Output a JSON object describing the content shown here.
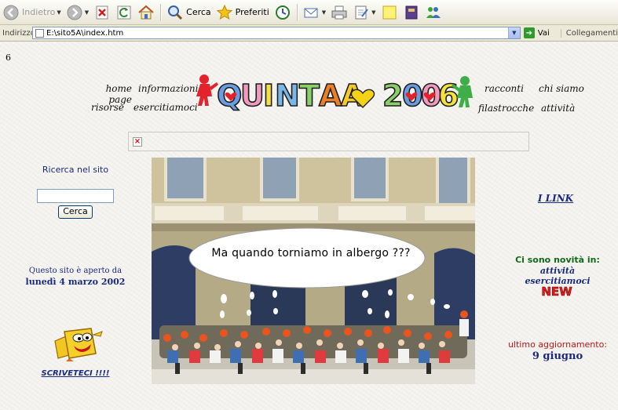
{
  "toolbar": {
    "back_label": "Indietro",
    "search_label": "Cerca",
    "favorites_label": "Preferiti"
  },
  "address": {
    "label": "Indirizzo",
    "url": "E:\\sito5A\\index.htm",
    "go_label": "Vai",
    "links_label": "Collegamenti"
  },
  "page": {
    "counter": "6",
    "nav": {
      "home": "home page",
      "informazioni": "informazioni",
      "risorse": "risorse",
      "esercitiamoci": "esercitiamoci",
      "racconti": "racconti",
      "chi_siamo": "chi siamo",
      "filastrocche": "filastrocche",
      "attivita": "attività"
    },
    "banner_text": "QUINTA A 2006",
    "search": {
      "title": "Ricerca nel sito",
      "button": "Cerca",
      "value": ""
    },
    "since_line1": "Questo sito è aperto da",
    "since_line2": "lunedì 4 marzo 2002",
    "write_link": "SCRIVETECI !!!!",
    "photo_caption": "Ma quando torniamo in albergo ???",
    "links_link": "I LINK",
    "news": {
      "title": "Ci sono novità in:",
      "item1": "attività",
      "item2": "esercitiamoci",
      "badge": "NEW"
    },
    "updated_label": "ultimo aggiornamento:",
    "updated_date": "9 giugno"
  }
}
